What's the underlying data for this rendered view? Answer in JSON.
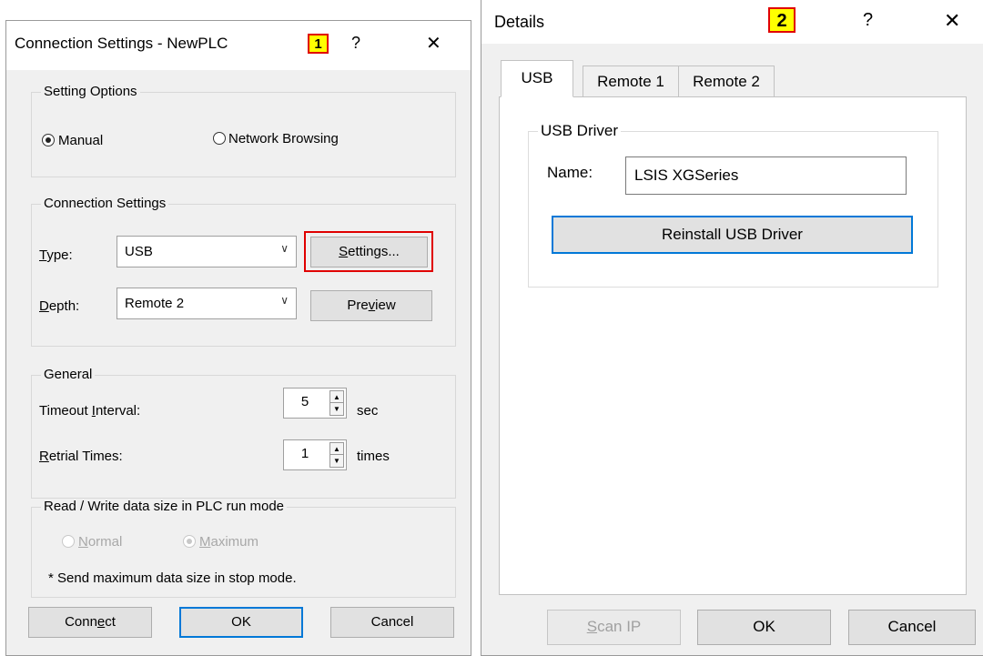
{
  "dialog1": {
    "title": "Connection Settings - NewPLC",
    "badge": "1",
    "help_icon": "?",
    "close_icon": "✕",
    "setting_options": {
      "group_label": "Setting Options",
      "manual_label": "Manual",
      "network_label": "Network Browsing",
      "selected": "Manual"
    },
    "connection_settings": {
      "group_label": "Connection Settings",
      "type_label": "Type:",
      "type_value": "USB",
      "settings_button": "Settings...",
      "depth_label": "Depth:",
      "depth_value": "Remote 2",
      "preview_button": "Preview"
    },
    "general": {
      "group_label": "General",
      "timeout_label": "Timeout Interval:",
      "timeout_value": "5",
      "timeout_unit": "sec",
      "retrial_label": "Retrial Times:",
      "retrial_value": "1",
      "retrial_unit": "times"
    },
    "rw_size": {
      "group_label": "Read / Write data size in PLC run mode",
      "normal_label": "Normal",
      "maximum_label": "Maximum",
      "selected": "Maximum",
      "note": "* Send maximum data size in stop mode."
    },
    "buttons": {
      "connect": "Connect",
      "ok": "OK",
      "cancel": "Cancel"
    }
  },
  "dialog2": {
    "title": "Details",
    "badge": "2",
    "help_icon": "?",
    "close_icon": "✕",
    "tabs": [
      "USB",
      "Remote 1",
      "Remote 2"
    ],
    "active_tab": "USB",
    "usb_driver": {
      "group_label": "USB Driver",
      "name_label": "Name:",
      "name_value": "LSIS XGSeries",
      "reinstall_button": "Reinstall USB Driver"
    },
    "buttons": {
      "scan_ip": "Scan IP",
      "ok": "OK",
      "cancel": "Cancel"
    }
  },
  "colors": {
    "highlight_border": "#e00000",
    "badge_fill": "#ffff00",
    "default_button_border": "#0078d7",
    "dialog_background": "#f0f0f0"
  }
}
